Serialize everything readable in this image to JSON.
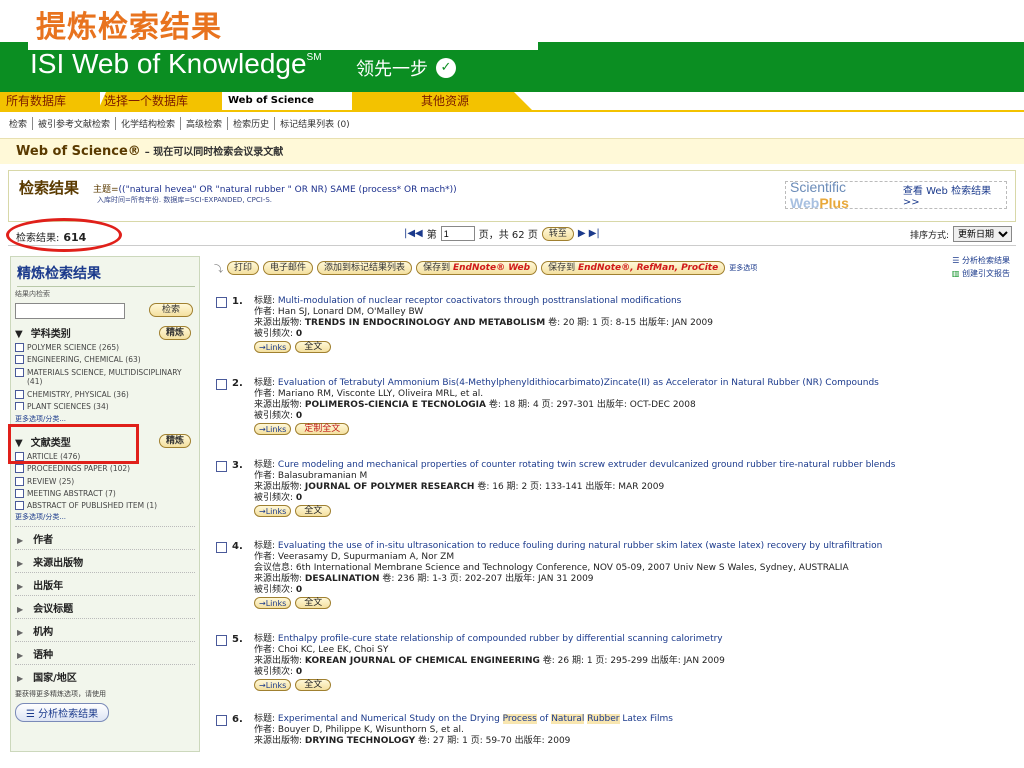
{
  "slide_title": "提炼检索结果",
  "banner": {
    "logo": "ISI Web of Knowledge",
    "logo_sup": "SM",
    "slogan": "领先一步",
    "slogan_icon": "check-circle-icon"
  },
  "tabs": {
    "all": "所有数据库",
    "choose": "选择一个数据库",
    "wos": "Web of Science",
    "other": "其他资源"
  },
  "subnav": [
    "检索",
    "被引参考文献检索",
    "化学结构检索",
    "高级检索",
    "检索历史",
    "标记结果列表 (0)"
  ],
  "wos_header": {
    "title": "Web of Science®",
    "subtitle": "– 现在可以同时检索会议录文献"
  },
  "search": {
    "label": "检索结果",
    "query_prefix": "主题=",
    "query": "((\"natural hevea\" OR \"natural rubber \" OR NR) SAME (process* OR mach*))",
    "meta": "入库时间=所有年份. 数据库=SCI-EXPANDED, CPCI-S."
  },
  "webplus": {
    "brand_a": "Scientific ",
    "brand_b": "Web",
    "brand_c": "Plus",
    "link": "查看 Web 检索结果 >>"
  },
  "results": {
    "count_label": "检索结果:",
    "count": "614",
    "page_prefix": "第",
    "page_value": "1",
    "page_suffix": "页，共 62 页",
    "goto": "转至",
    "sort_label": "排序方式:",
    "sort_value": "更新日期"
  },
  "toolbar": {
    "print": "打印",
    "email": "电子邮件",
    "add": "添加到标记结果列表",
    "save_to": "保存到",
    "endnote_web": "EndNote® Web",
    "save_to2": "保存到",
    "endnote2": "EndNote®, RefMan, ProCite",
    "more": "更多选项"
  },
  "tools_right": {
    "analyze": "分析检索结果",
    "cite_report": "创建引文报告"
  },
  "sidebar": {
    "title": "精炼检索结果",
    "within_label": "结果内检索",
    "search_btn": "检索",
    "subject_head": "学科类别",
    "refine_btn": "精炼",
    "subjects": [
      "POLYMER SCIENCE (265)",
      "ENGINEERING, CHEMICAL (63)",
      "MATERIALS SCIENCE, MULTIDISCIPLINARY (41)",
      "CHEMISTRY, PHYSICAL (36)",
      "PLANT SCIENCES (34)"
    ],
    "more1": "更多选项/分类...",
    "doctype_head": "文献类型",
    "refine_btn2": "精炼",
    "doctypes": [
      "ARTICLE (476)",
      "PROCEEDINGS PAPER (102)",
      "REVIEW (25)",
      "MEETING ABSTRACT (7)",
      "ABSTRACT OF PUBLISHED ITEM (1)"
    ],
    "more2": "更多选项/分类...",
    "collapsed": [
      "作者",
      "来源出版物",
      "出版年",
      "会议标题",
      "机构",
      "语种",
      "国家/地区"
    ],
    "note": "要获得更多精炼选项，请使用",
    "analyze_btn": "分析检索结果"
  },
  "records": [
    {
      "num": "1.",
      "title_label": "标题:",
      "title": "Multi-modulation of nuclear receptor coactivators through posttranslational modifications",
      "author_label": "作者:",
      "authors": "Han SJ, Lonard DM, O'Malley BW",
      "src_label": "来源出版物:",
      "source": "TRENDS IN ENDOCRINOLOGY AND METABOLISM",
      "details": "卷: 20  期: 1  页: 8-15  出版年: JAN 2009",
      "cited_label": "被引频次:",
      "cited": "0",
      "links": "Links",
      "fulltext": "全文"
    },
    {
      "num": "2.",
      "title_label": "标题:",
      "title": "Evaluation of Tetrabutyl Ammonium Bis(4-Methylphenyldithiocarbimato)Zincate(II) as Accelerator in Natural Rubber (NR) Compounds",
      "author_label": "作者:",
      "authors": "Mariano RM, Visconte LLY, Oliveira MRL, et al.",
      "src_label": "来源出版物:",
      "source": "POLIMEROS-CIENCIA E TECNOLOGIA",
      "details": "卷: 18  期: 4  页: 297-301  出版年: OCT-DEC 2008",
      "cited_label": "被引频次:",
      "cited": "0",
      "links": "Links",
      "fulltext": "定制全文"
    },
    {
      "num": "3.",
      "title_label": "标题:",
      "title": "Cure modeling and mechanical properties of counter rotating twin screw extruder devulcanized ground rubber tire-natural rubber blends",
      "author_label": "作者:",
      "authors": "Balasubramanian M",
      "src_label": "来源出版物:",
      "source": "JOURNAL OF POLYMER RESEARCH",
      "details": "卷: 16  期: 2  页: 133-141  出版年: MAR 2009",
      "cited_label": "被引频次:",
      "cited": "0",
      "links": "Links",
      "fulltext": "全文"
    },
    {
      "num": "4.",
      "title_label": "标题:",
      "title": "Evaluating the use of in-situ ultrasonication to reduce fouling during natural rubber skim latex (waste latex) recovery by ultrafiltration",
      "author_label": "作者:",
      "authors": "Veerasamy D, Supurmaniam A, Nor ZM",
      "conf_label": "会议信息:",
      "conf": "6th International Membrane Science and Technology Conference, NOV 05-09, 2007 Univ New S Wales, Sydney, AUSTRALIA",
      "src_label": "来源出版物:",
      "source": "DESALINATION",
      "details": "卷: 236  期: 1-3  页: 202-207  出版年: JAN 31 2009",
      "cited_label": "被引频次:",
      "cited": "0",
      "links": "Links",
      "fulltext": "全文"
    },
    {
      "num": "5.",
      "title_label": "标题:",
      "title": "Enthalpy profile-cure state relationship of compounded rubber by differential scanning calorimetry",
      "author_label": "作者:",
      "authors": "Choi KC, Lee EK, Choi SY",
      "src_label": "来源出版物:",
      "source": "KOREAN JOURNAL OF CHEMICAL ENGINEERING",
      "details": "卷: 26  期: 1  页: 295-299  出版年: JAN 2009",
      "cited_label": "被引频次:",
      "cited": "0",
      "links": "Links",
      "fulltext": "全文"
    },
    {
      "num": "6.",
      "title_label": "标题:",
      "title_a": "Experimental and Numerical Study on the Drying ",
      "title_b": "Process",
      "title_c": " of ",
      "title_d": "Natural",
      "title_e": " ",
      "title_f": "Rubber",
      "title_g": " Latex Films",
      "author_label": "作者:",
      "authors": "Bouyer D, Philippe K, Wisunthorn S, et al.",
      "src_label": "来源出版物:",
      "source": "DRYING TECHNOLOGY",
      "details": "卷: 27  期: 1  页: 59-70  出版年: 2009"
    }
  ]
}
